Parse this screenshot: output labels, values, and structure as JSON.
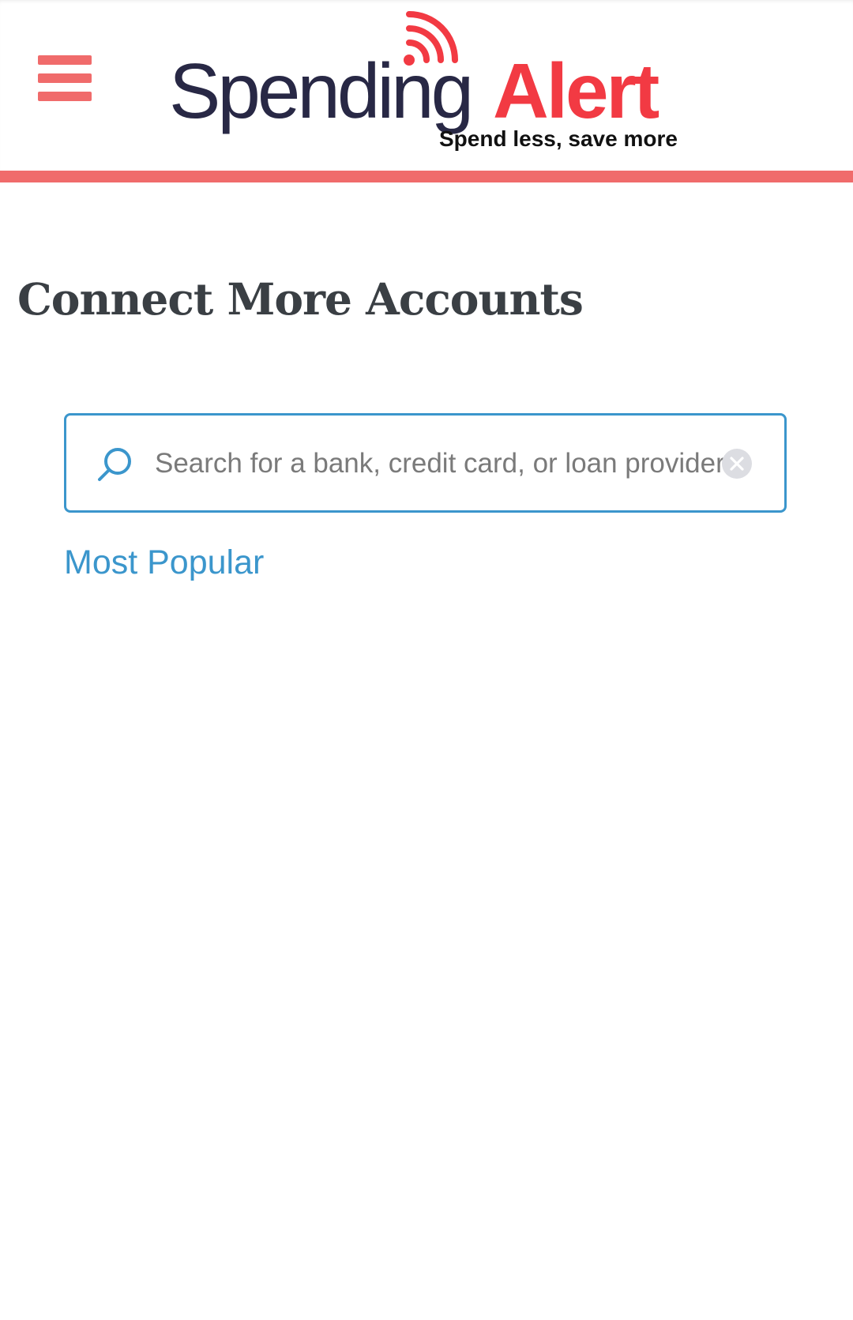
{
  "header": {
    "menu_icon": "hamburger-menu-icon",
    "logo": {
      "word_1": "Spending",
      "word_2": "Alert",
      "tagline": "Spend less, save more",
      "signal_icon": "signal-waves-icon"
    }
  },
  "main": {
    "title": "Connect More Accounts",
    "search": {
      "placeholder": "Search for a bank, credit card, or loan provider",
      "value": "",
      "search_icon": "search-icon",
      "clear_icon": "clear-icon"
    },
    "most_popular_label": "Most Popular"
  },
  "colors": {
    "accent": "#f06b6b",
    "brand_red": "#f23a43",
    "brand_dark": "#282845",
    "link_blue": "#3b96cc",
    "title_text": "#3a3f44"
  }
}
